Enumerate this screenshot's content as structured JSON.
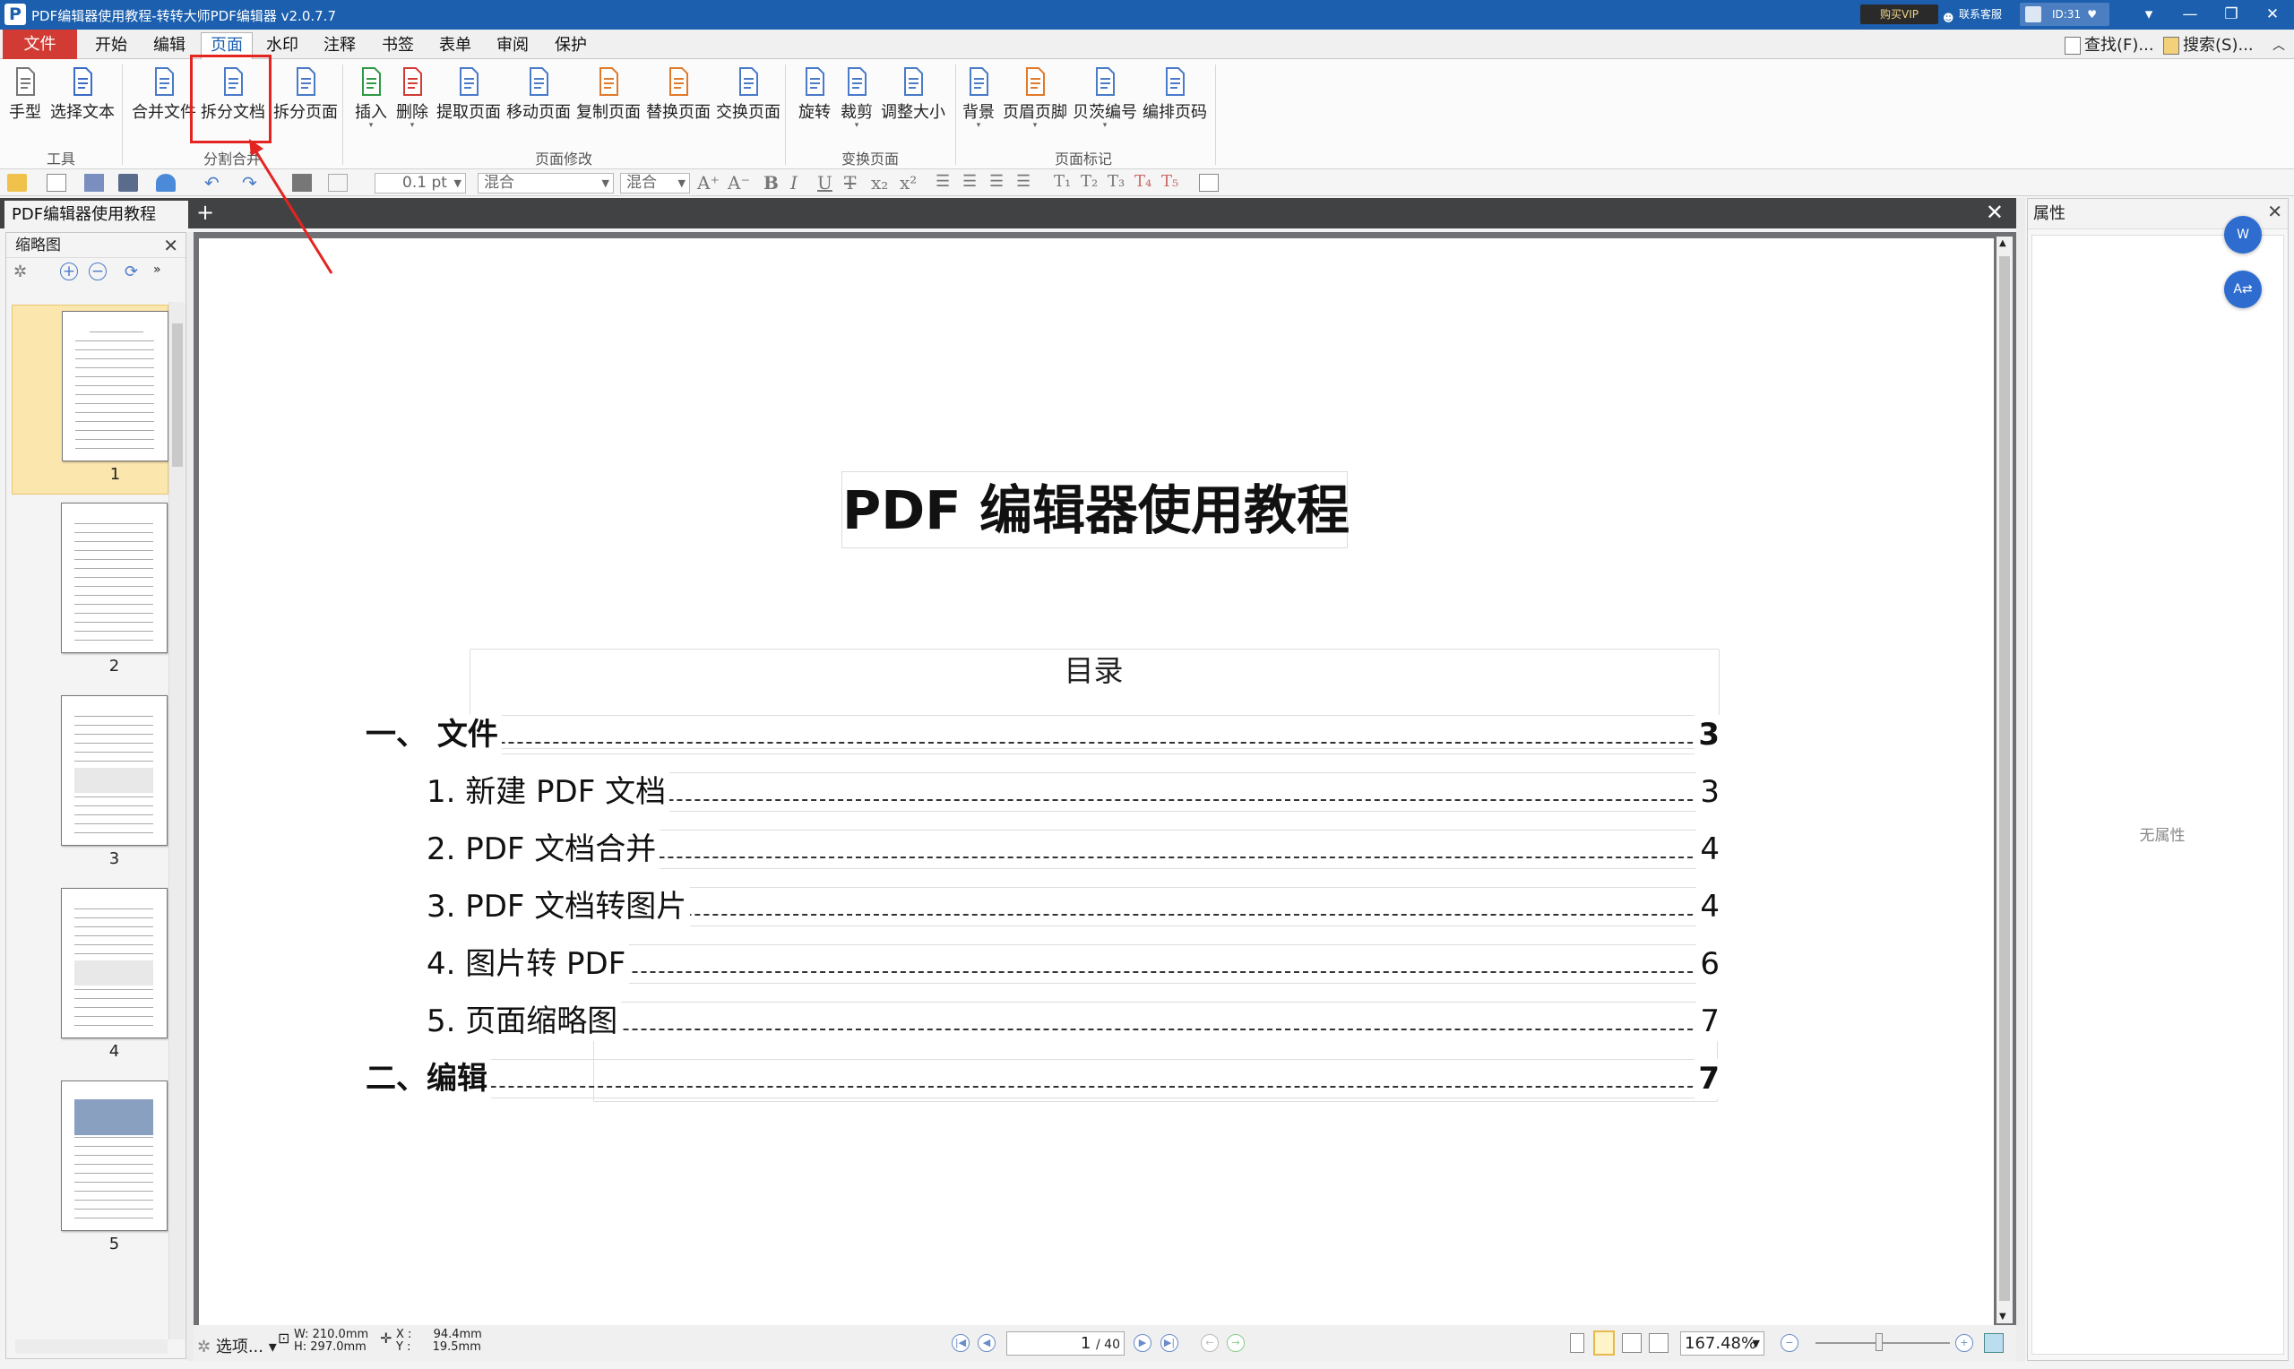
{
  "window": {
    "title": "PDF编辑器使用教程-转转大师PDF编辑器 v2.0.7.7",
    "vip_label": "购买VIP",
    "service_label": "联系客服",
    "user_id": "ID:31"
  },
  "menu": {
    "file": "文件",
    "items": [
      "开始",
      "编辑",
      "页面",
      "水印",
      "注释",
      "书签",
      "表单",
      "审阅",
      "保护"
    ],
    "active": "页面",
    "find": "查找(F)...",
    "search": "搜索(S)..."
  },
  "ribbon": {
    "buttons": {
      "hand": "手型",
      "select_text": "选择文本",
      "merge": "合并文件",
      "split_doc": "拆分文档",
      "split_page": "拆分页面",
      "insert": "插入",
      "delete": "删除",
      "extract": "提取页面",
      "move": "移动页面",
      "copy": "复制页面",
      "replace": "替换页面",
      "swap": "交换页面",
      "rotate": "旋转",
      "crop": "裁剪",
      "resize": "调整大小",
      "background": "背景",
      "header_footer": "页眉页脚",
      "bates": "贝茨编号",
      "page_number": "编排页码"
    },
    "groups": {
      "tools": "工具",
      "split_merge": "分割合并",
      "page_modify": "页面修改",
      "transform": "变换页面",
      "page_mark": "页面标记"
    }
  },
  "quickbar": {
    "line_width": "0.1 pt",
    "font": "混合",
    "font_size": "混合"
  },
  "tabs": {
    "doc": "PDF编辑器使用教程"
  },
  "thumbnails": {
    "title": "缩略图",
    "pages": [
      "1",
      "2",
      "3",
      "4",
      "5"
    ],
    "selected": "1"
  },
  "document": {
    "title": "PDF 编辑器使用教程",
    "toc_heading": "目录",
    "toc": [
      {
        "text": "一、 文件",
        "page": "3"
      },
      {
        "text": "1. 新建 PDF 文档",
        "page": "3"
      },
      {
        "text": "2. PDF 文档合并",
        "page": "4"
      },
      {
        "text": "3. PDF 文档转图片",
        "page": "4"
      },
      {
        "text": "4. 图片转 PDF",
        "page": "6"
      },
      {
        "text": "5. 页面缩略图",
        "page": "7"
      },
      {
        "text": "二、编辑",
        "page": "7"
      }
    ]
  },
  "status": {
    "options": "选项...",
    "w": "W: 210.0mm",
    "h": "H: 297.0mm",
    "x_label": "X :",
    "x": "94.4mm",
    "y_label": "Y :",
    "y": "19.5mm",
    "page": "1",
    "page_total": "/ 40",
    "zoom": "167.48%"
  },
  "properties": {
    "title": "属性",
    "empty": "无属性"
  },
  "colors": {
    "titlebar": "#1b5fae",
    "file_tab": "#d23b33",
    "annotation": "#e32420",
    "thumb_selected": "#fbe6ae"
  }
}
